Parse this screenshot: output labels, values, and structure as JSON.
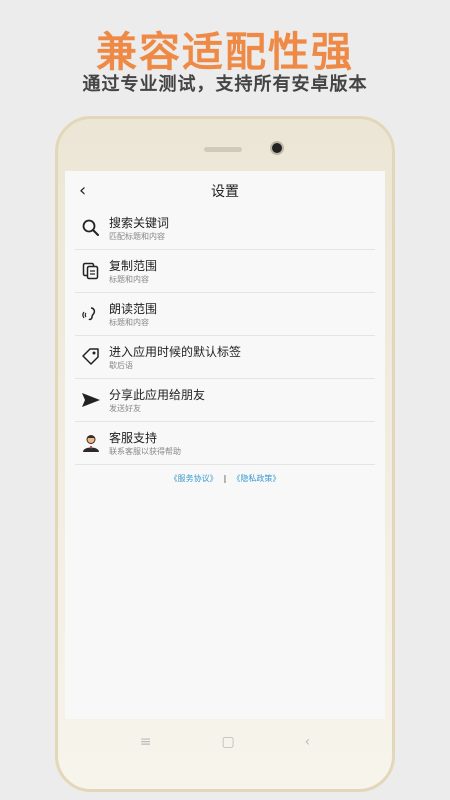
{
  "promo": {
    "headline": "兼容适配性强",
    "subline": "通过专业测试，支持所有安卓版本"
  },
  "header": {
    "back_glyph": "‹",
    "title": "设置"
  },
  "settings": [
    {
      "icon": "search-icon",
      "title": "搜索关键词",
      "subtitle": "匹配标题和内容"
    },
    {
      "icon": "copy-icon",
      "title": "复制范围",
      "subtitle": "标题和内容"
    },
    {
      "icon": "read-aloud-icon",
      "title": "朗读范围",
      "subtitle": "标题和内容"
    },
    {
      "icon": "tag-icon",
      "title": "进入应用时候的默认标签",
      "subtitle": "歇后语"
    },
    {
      "icon": "send-icon",
      "title": "分享此应用给朋友",
      "subtitle": "发送好友"
    },
    {
      "icon": "support-agent-icon",
      "title": "客服支持",
      "subtitle": "联系客服以获得帮助"
    }
  ],
  "links": {
    "service": "《服务协议》",
    "separator": "|",
    "privacy": "《隐私政策》"
  },
  "navbar": {
    "menu_glyph": "≡",
    "home_glyph": "▢",
    "back_glyph": "‹"
  },
  "colors": {
    "accent": "#ee8a45",
    "link": "#3a9ad0"
  }
}
